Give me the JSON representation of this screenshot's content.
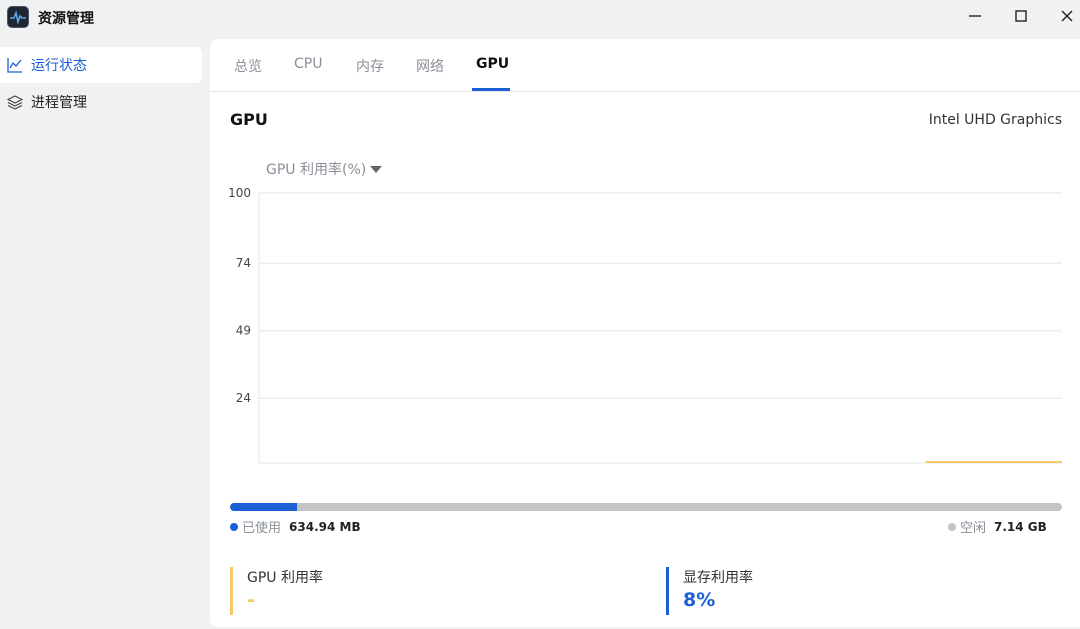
{
  "app": {
    "title": "资源管理"
  },
  "window_controls": {
    "minimize_icon": "minimize-icon",
    "maximize_icon": "maximize-icon",
    "close_icon": "close-icon"
  },
  "sidebar": {
    "items": [
      {
        "label": "运行状态",
        "icon": "line-chart-icon",
        "active": true
      },
      {
        "label": "进程管理",
        "icon": "layers-icon",
        "active": false
      }
    ]
  },
  "tabs": [
    {
      "label": "总览"
    },
    {
      "label": "CPU"
    },
    {
      "label": "内存"
    },
    {
      "label": "网络"
    },
    {
      "label": "GPU",
      "active": true
    }
  ],
  "gpu": {
    "header": "GPU",
    "device_name": "Intel UHD Graphics",
    "metric_select": "GPU 利用率(%)"
  },
  "chart_data": {
    "type": "line",
    "ylabel": "GPU 利用率(%)",
    "yticks": [
      "100",
      "74",
      "49",
      "24"
    ],
    "ytick_values": [
      100,
      74,
      49,
      24
    ],
    "ylim": [
      0,
      100
    ],
    "grid": true,
    "series": [
      {
        "color": "#f5c86b",
        "x_fraction_start": 0.83,
        "values": [
          0,
          0,
          0,
          0,
          0
        ]
      }
    ]
  },
  "memory": {
    "used_fraction": 0.08,
    "used_label": "已使用",
    "used_value": "634.94 MB",
    "free_label": "空闲",
    "free_value": "7.14 GB",
    "used_color": "#1d5fd6",
    "free_color": "#c4c4c4"
  },
  "stats": {
    "gpu_util": {
      "title": "GPU 利用率",
      "value": "-",
      "color": "#f5c86b"
    },
    "vram_util": {
      "title": "显存利用率",
      "value": "8%",
      "color": "#1d5fd6"
    }
  }
}
